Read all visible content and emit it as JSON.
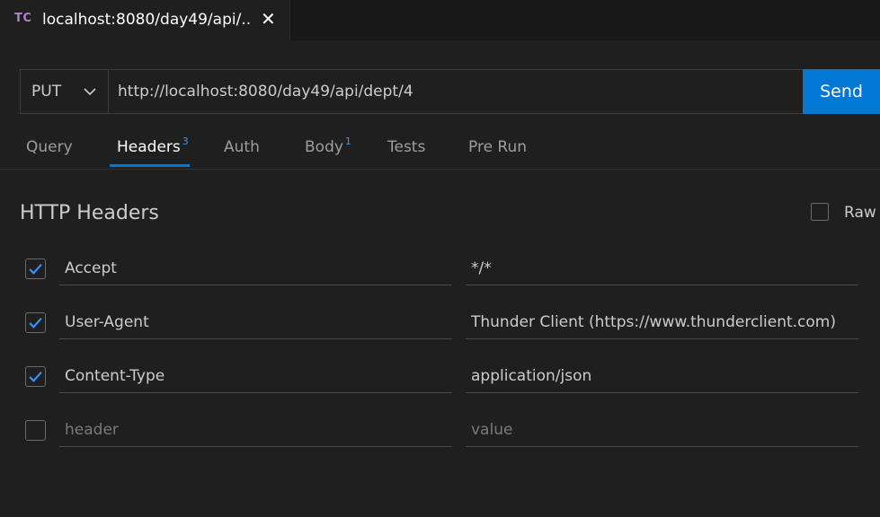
{
  "tab": {
    "logo": "TC",
    "title": "localhost:8080/day49/api/..",
    "close": "✕"
  },
  "request": {
    "method": "PUT",
    "url": "http://localhost:8080/day49/api/dept/4",
    "send_label": "Send"
  },
  "subtabs": [
    {
      "label": "Query",
      "badge": ""
    },
    {
      "label": "Headers",
      "badge": "3"
    },
    {
      "label": "Auth",
      "badge": ""
    },
    {
      "label": "Body",
      "badge": "1"
    },
    {
      "label": "Tests",
      "badge": ""
    },
    {
      "label": "Pre Run",
      "badge": ""
    }
  ],
  "active_subtab": "Headers",
  "headers_section": {
    "title": "HTTP Headers",
    "raw_label": "Raw",
    "rows": [
      {
        "checked": true,
        "key": "Accept",
        "value": "*/*"
      },
      {
        "checked": true,
        "key": "User-Agent",
        "value": "Thunder Client (https://www.thunderclient.com)"
      },
      {
        "checked": true,
        "key": "Content-Type",
        "value": "application/json"
      },
      {
        "checked": false,
        "key": "",
        "value": ""
      }
    ],
    "key_placeholder": "header",
    "value_placeholder": "value"
  },
  "colors": {
    "accent": "#0078d4",
    "check": "#3794ff",
    "logo": "#b180d7"
  }
}
